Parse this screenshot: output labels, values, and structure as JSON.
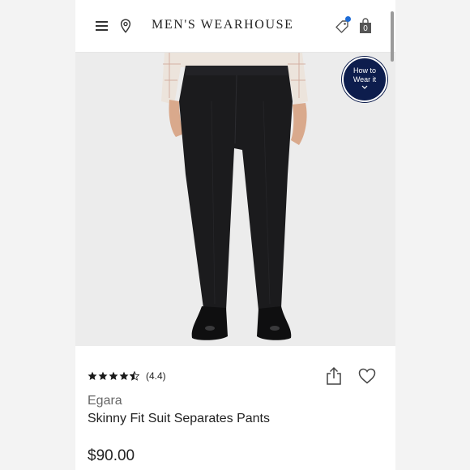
{
  "app": {
    "brand_name": "MEN'S WEARHOUSE",
    "bag_count": "0",
    "accent_color": "#1c6bd6",
    "badge_color": "#0d1d4d"
  },
  "header": {
    "icons": [
      "menu-icon",
      "location-pin-icon",
      "tag-icon",
      "shopping-bag-icon"
    ]
  },
  "hero": {
    "how_to_wear_line1": "How to",
    "how_to_wear_line2": "Wear it"
  },
  "product": {
    "rating_value": 4.4,
    "rating_text": "(4.4)",
    "brand": "Egara",
    "title": "Skinny Fit Suit Separates Pants",
    "price": "$90.00",
    "actions": [
      "share-icon",
      "heart-icon"
    ]
  }
}
